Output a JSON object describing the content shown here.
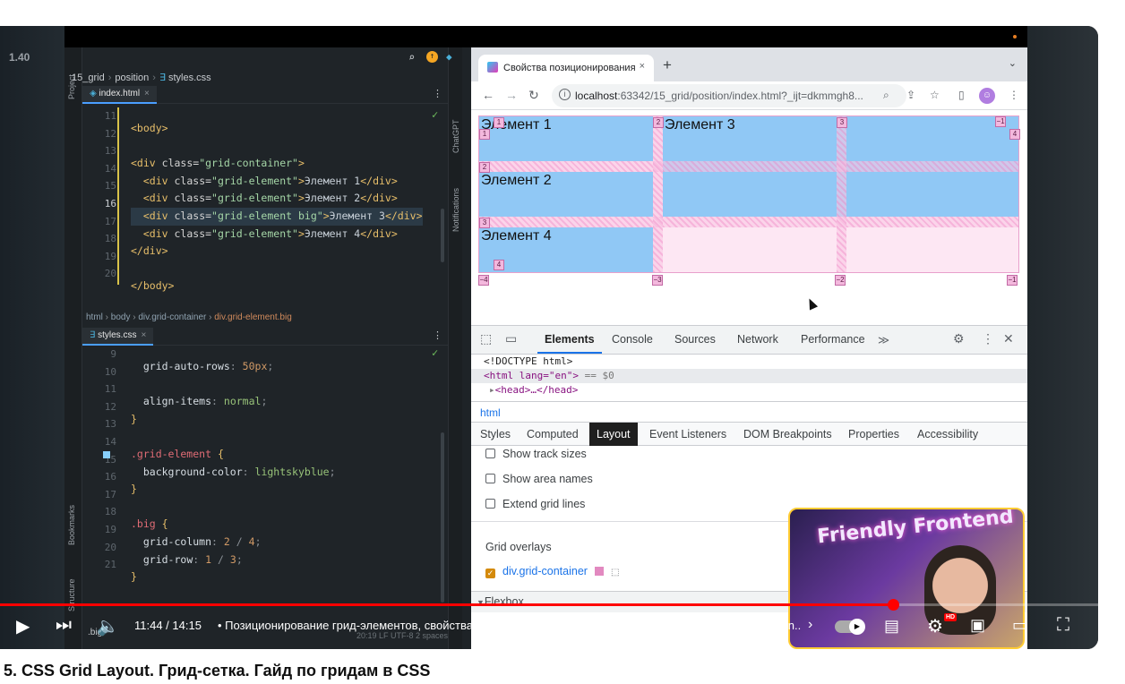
{
  "player": {
    "speed": "1.40"
  },
  "ide": {
    "project_label": "Project",
    "bookmarks_label": "Bookmarks",
    "structure_label": "Structure",
    "chatgpt_label": "ChatGPT",
    "notifications_label": "Notifications",
    "breadcrumb": [
      "15_grid",
      "position",
      "styles.css"
    ],
    "html_tab": "index.html",
    "css_tab": "styles.css",
    "html_lines": [
      "11",
      "12",
      "13",
      "14",
      "15",
      "16",
      "17",
      "18",
      "19",
      "20"
    ],
    "css_lines": [
      "9",
      "10",
      "11",
      "12",
      "13",
      "14",
      "15",
      "16",
      "17",
      "18",
      "19",
      "20",
      "21"
    ],
    "path": [
      "html",
      "body",
      "div.grid-container",
      "div.grid-element.big"
    ],
    "selection": ".big",
    "status": "20:19   LF   UTF-8   2 spaces"
  },
  "browser": {
    "tab_title": "Свойства позиционирования",
    "url_host": "localhost",
    "url_rest": ":63342/15_grid/position/index.html?_ijt=dkmmgh8...",
    "grid_items": [
      "Элемент 1",
      "Элемент 2",
      "Элемент 3",
      "Элемент 4"
    ],
    "devtools_tabs": [
      "Elements",
      "Console",
      "Sources",
      "Network",
      "Performance"
    ],
    "dom": {
      "doctype": "<!DOCTYPE html>",
      "html_open": "<html lang=\"en\">",
      "html_suffix": " == $0",
      "head": "<head>…</head>"
    },
    "dom_crumb": "html",
    "sub_tabs": [
      "Styles",
      "Computed",
      "Layout",
      "Event Listeners",
      "DOM Breakpoints",
      "Properties",
      "Accessibility"
    ],
    "options": [
      "Show track sizes",
      "Show area names",
      "Extend grid lines"
    ],
    "grid_overlays_title": "Grid overlays",
    "grid_overlay_item": "div.grid-container",
    "flexbox_label": "Flexbox"
  },
  "webcam": {
    "sign": "Friendly Frontend"
  },
  "controls": {
    "time": "11:44 / 14:15",
    "chapter": "• Позиционирование грид-элементов, свойства grid-column-start, grid-column-end, grid-row-start, grid-row-en...",
    "progress": 0.813,
    "hd_badge": "HD"
  },
  "video_title": "5. CSS Grid Layout. Грид-сетка. Гайд по гридам в CSS"
}
